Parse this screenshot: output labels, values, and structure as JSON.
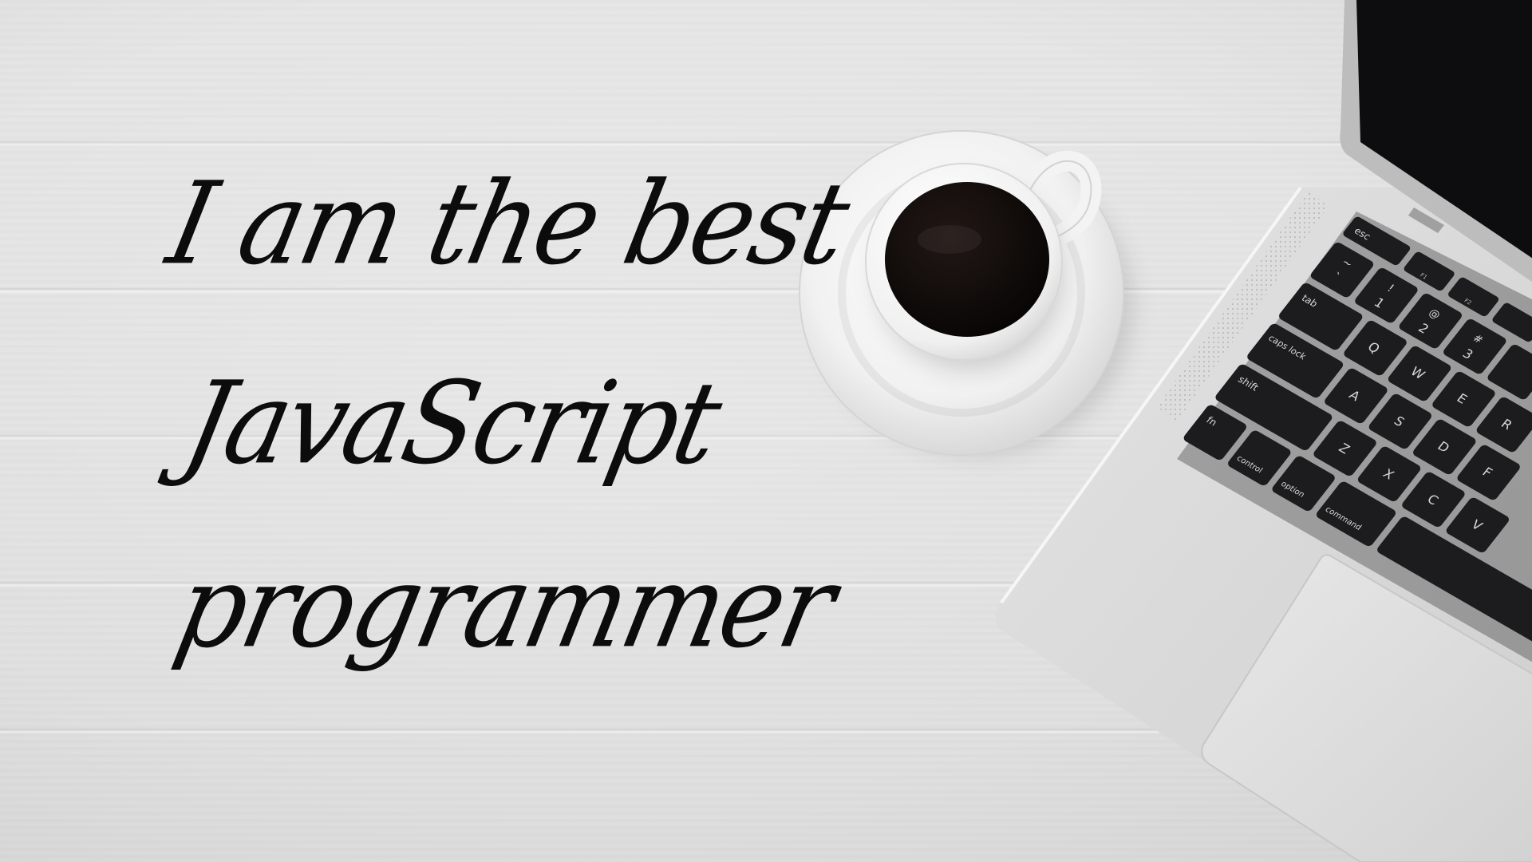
{
  "quote": {
    "line1": "I am the best",
    "line2": "JavaScript",
    "line3": "programmer"
  },
  "keyboard": {
    "labels": {
      "esc": "esc",
      "tab": "tab",
      "caps": "caps lock",
      "shift": "shift",
      "fn": "fn",
      "control": "control",
      "option": "option",
      "command": "command",
      "tilde": "~",
      "backtick": "`",
      "one": "1",
      "excl": "!",
      "two": "2",
      "at": "@",
      "three": "3",
      "hash": "#",
      "q": "Q",
      "w": "W",
      "e": "E",
      "r": "R",
      "a": "A",
      "s": "S",
      "d": "D",
      "f": "F",
      "z": "Z",
      "x": "X",
      "c": "C",
      "v": "V",
      "f1": "F1",
      "f2": "F2"
    }
  },
  "colors": {
    "table": "#e3e3e3",
    "ink": "#0c0c0c",
    "coffee": "#0f0b0a",
    "porcelain": "#f7f7f7",
    "laptop_body": "#dcdcdc",
    "keys": "#1c1c1e",
    "screen": "#0d0d0f"
  }
}
